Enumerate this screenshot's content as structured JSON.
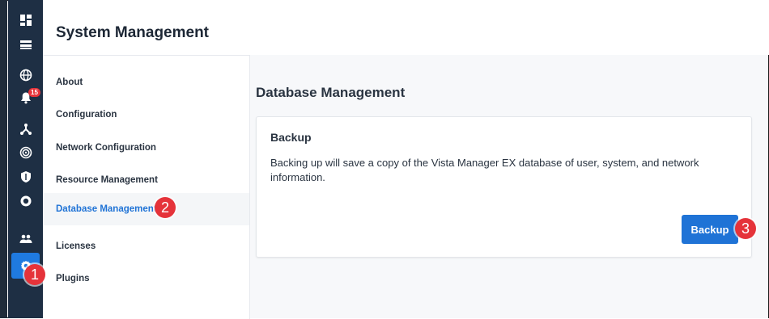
{
  "header": {
    "title": "System Management"
  },
  "rail": {
    "notification_count": "15",
    "icons": [
      "dashboard-icon",
      "list-icon",
      "globe-icon",
      "bell-icon",
      "topology-icon",
      "target-icon",
      "shield-icon",
      "cloud-icon",
      "users-icon",
      "settings-icon"
    ]
  },
  "menu": {
    "items": [
      {
        "label": "About"
      },
      {
        "label": "Configuration"
      },
      {
        "label": "Network Configuration"
      },
      {
        "label": "Resource Management"
      },
      {
        "label": "Database Management"
      },
      {
        "label": "Licenses"
      },
      {
        "label": "Plugins"
      }
    ],
    "selected": "Database Management"
  },
  "main": {
    "section_title": "Database Management",
    "card": {
      "title": "Backup",
      "description": "Backing up will save a copy of the Vista Manager EX database of user, system, and network information.",
      "button_label": "Backup"
    }
  },
  "callouts": [
    "1",
    "2",
    "3"
  ],
  "colors": {
    "accent": "#1f73d6",
    "rail": "#1e2f44",
    "callout": "#e5333a"
  }
}
